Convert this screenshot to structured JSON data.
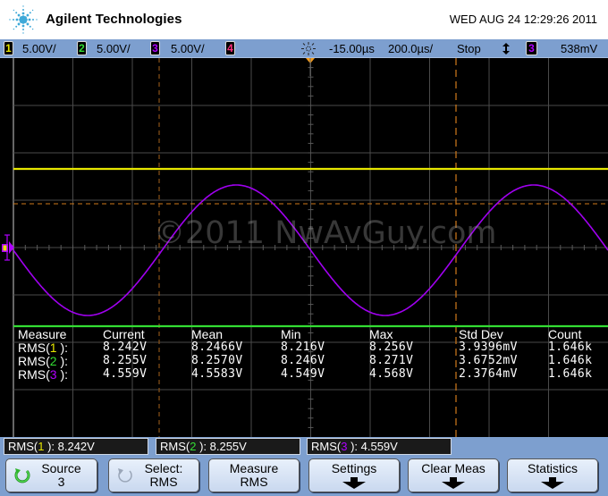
{
  "header": {
    "brand": "Agilent Technologies",
    "datetime": "WED AUG 24 12:29:26 2011",
    "logo_icon": "agilent-spark-logo"
  },
  "status_bar": {
    "channels": [
      {
        "number": "1",
        "scale": "5.00V/",
        "color": "#e6e600"
      },
      {
        "number": "2",
        "scale": "5.00V/",
        "color": "#33dd33"
      },
      {
        "number": "3",
        "scale": "5.00V/",
        "color": "#b000ff"
      },
      {
        "number": "4",
        "scale": "",
        "color": "#ff3080"
      }
    ],
    "trigger_icon": "trigger-sun-icon",
    "delay": "-15.00µs",
    "timebase": "200.0µs/",
    "run_state": "Stop",
    "trigger_slope_icon": "up-down-arrow-icon",
    "trigger_source": "3",
    "trigger_level": "538mV"
  },
  "display": {
    "watermark": "©2011 NwAvGuy.com",
    "colors": {
      "ch1": "#e6e600",
      "ch2": "#33dd33",
      "ch3": "#b000ff",
      "cursor": "#d07a1a",
      "grid": "#444444"
    },
    "grid_divisions": {
      "horizontal": 10,
      "vertical": 8
    },
    "ch3_wave": {
      "cycles_on_screen": 2.0,
      "phase": "falling at left edge"
    }
  },
  "measurements": {
    "headers": [
      "Measure",
      "Current",
      "Mean",
      "Min",
      "Max",
      "Std Dev",
      "Count"
    ],
    "rows": [
      {
        "label_pre": "RMS(",
        "ch": "1",
        "label_post": " ):",
        "current": "8.242V",
        "mean": "8.2466V",
        "min": "8.216V",
        "max": "8.256V",
        "std_dev": "3.9396mV",
        "count": "1.646k"
      },
      {
        "label_pre": "RMS(",
        "ch": "2",
        "label_post": " ):",
        "current": "8.255V",
        "mean": "8.2570V",
        "min": "8.246V",
        "max": "8.271V",
        "std_dev": "3.6752mV",
        "count": "1.646k"
      },
      {
        "label_pre": "RMS(",
        "ch": "3",
        "label_post": " ):",
        "current": "4.559V",
        "mean": "4.5583V",
        "min": "4.549V",
        "max": "4.568V",
        "std_dev": "2.3764mV",
        "count": "1.646k"
      }
    ]
  },
  "readouts": [
    {
      "pre": "RMS(",
      "ch": "1",
      "post": " ): 8.242V"
    },
    {
      "pre": "RMS(",
      "ch": "2",
      "post": " ): 8.255V"
    },
    {
      "pre": "RMS(",
      "ch": "3",
      "post": " ): 4.559V"
    }
  ],
  "softkeys": [
    {
      "line1": "Source",
      "line2": "3",
      "icon": "rotate-knob-icon",
      "icon_active": true
    },
    {
      "line1": "Select:",
      "line2": "RMS",
      "icon": "rotate-knob-icon",
      "icon_active": false
    },
    {
      "line1": "Measure",
      "line2": "RMS"
    },
    {
      "line1": "Settings",
      "icon": "down-arrow-icon"
    },
    {
      "line1": "Clear Meas",
      "icon": "down-arrow-icon"
    },
    {
      "line1": "Statistics",
      "icon": "down-arrow-icon"
    }
  ]
}
